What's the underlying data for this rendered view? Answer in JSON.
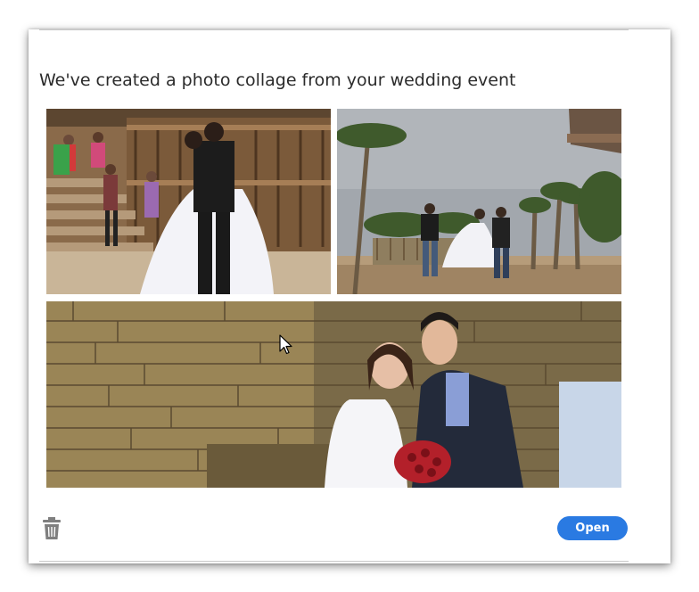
{
  "dialog": {
    "title": "We've created a photo collage from your wedding event",
    "open_label": "Open"
  },
  "icons": {
    "delete": "trash-icon",
    "pointer": "mouse-cursor-icon"
  },
  "colors": {
    "accent": "#2a7ae2",
    "title_text": "#2b2b2b",
    "trash": "#7f7f7f"
  }
}
